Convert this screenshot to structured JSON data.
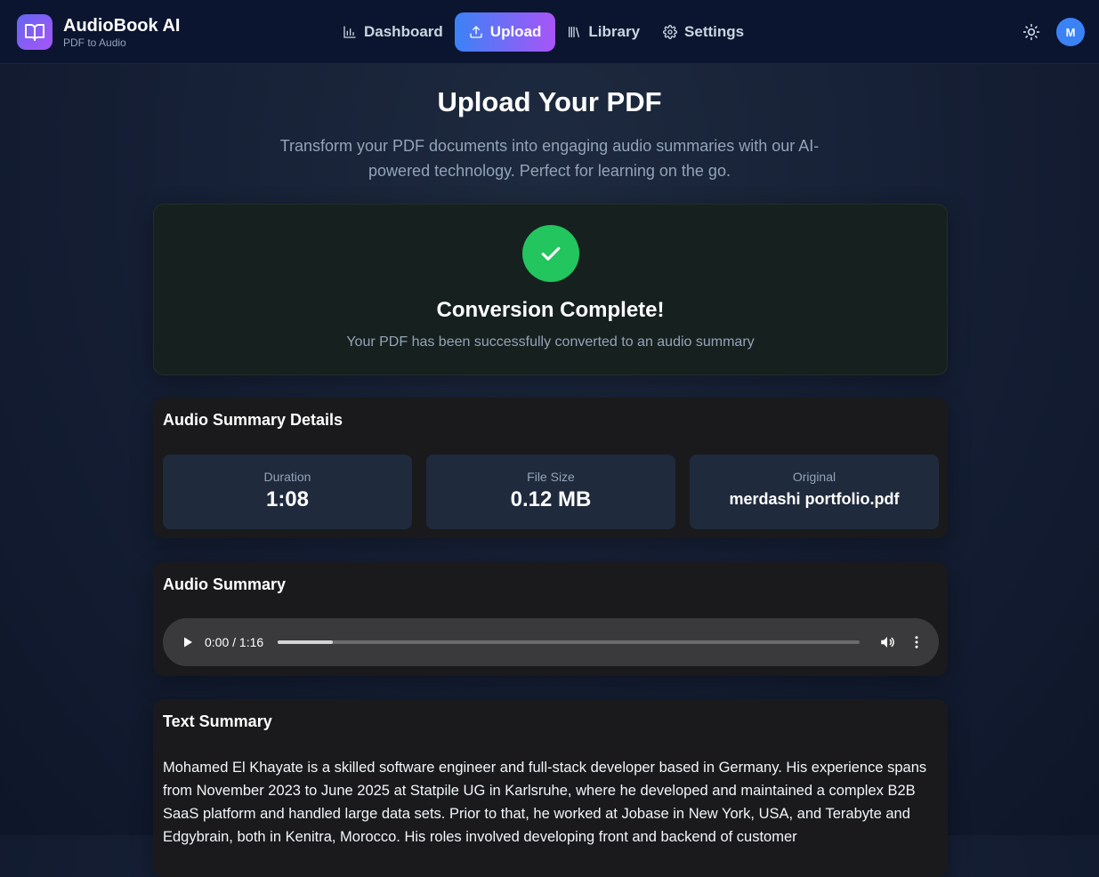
{
  "brand": {
    "title": "AudioBook AI",
    "subtitle": "PDF to Audio"
  },
  "nav": {
    "dashboard": "Dashboard",
    "upload": "Upload",
    "library": "Library",
    "settings": "Settings"
  },
  "user": {
    "initial": "M"
  },
  "page": {
    "title": "Upload Your PDF",
    "description": "Transform your PDF documents into engaging audio summaries with our AI-powered technology. Perfect for learning on the go."
  },
  "success": {
    "title": "Conversion Complete!",
    "subtitle": "Your PDF has been successfully converted to an audio summary"
  },
  "details": {
    "title": "Audio Summary Details",
    "duration_label": "Duration",
    "duration_value": "1:08",
    "size_label": "File Size",
    "size_value": "0.12 MB",
    "original_label": "Original",
    "original_value": "merdashi portfolio.pdf"
  },
  "audio": {
    "title": "Audio Summary",
    "time": "0:00 / 1:16",
    "progress_fraction": 0.095
  },
  "text_summary": {
    "title": "Text Summary",
    "body": "Mohamed El Khayate is a skilled software engineer and full-stack developer based in Germany. His experience spans from November 2023 to June 2025 at Statpile UG in Karlsruhe, where he developed and maintained a complex B2B SaaS platform and handled large data sets. Prior to that, he worked at Jobase in New York, USA, and Terabyte and Edgybrain, both in Kenitra, Morocco. His roles involved developing front and backend of customer"
  },
  "colors": {
    "accent_start": "#3b82f6",
    "accent_end": "#a855f7",
    "success": "#22c55e",
    "background": "#162036"
  },
  "icons": [
    "book-open-icon",
    "bar-chart-icon",
    "upload-icon",
    "library-icon",
    "gear-icon",
    "sun-icon",
    "check-icon",
    "play-icon",
    "volume-icon",
    "more-vertical-icon"
  ]
}
